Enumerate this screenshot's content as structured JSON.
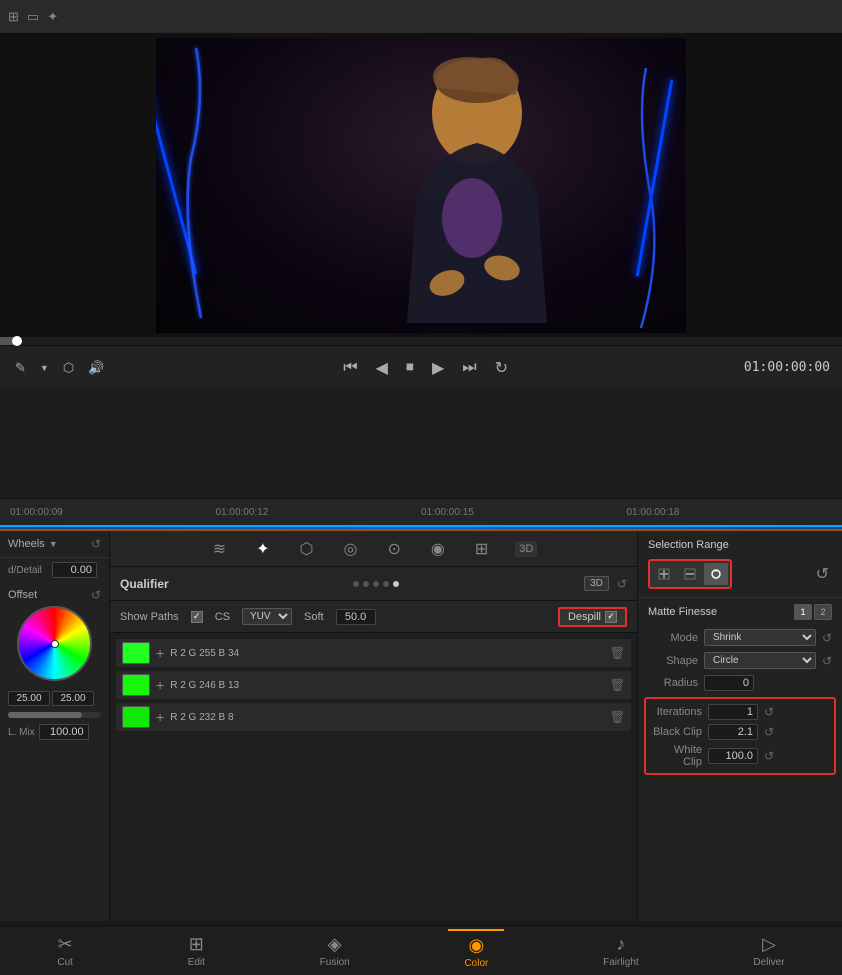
{
  "topToolbar": {
    "icons": [
      "grid-icon",
      "monitor-icon",
      "magic-icon"
    ]
  },
  "videoPreview": {
    "timecode": "01:00:00:00"
  },
  "playback": {
    "controls": [
      "skip-back",
      "step-back",
      "stop",
      "play",
      "step-forward",
      "loop"
    ],
    "timecode": "01:00:00:00"
  },
  "timeline": {
    "marks": [
      "01:00:00:09",
      "01:00:00:12",
      "01:00:00:15",
      "01:00:00:18"
    ]
  },
  "leftPanel": {
    "wheels_label": "Wheels",
    "detail_label": "d/Detail",
    "detail_value": "0.00",
    "offset_label": "Offset",
    "low_value": "25.00",
    "high_value": "25.00",
    "lmix_label": "L. Mix",
    "lmix_value": "100.00"
  },
  "toolIcons": [
    {
      "name": "curves-icon",
      "symbol": "≋"
    },
    {
      "name": "qualifier-icon",
      "symbol": "✦"
    },
    {
      "name": "pipette-icon",
      "symbol": "⬡"
    },
    {
      "name": "vignette-icon",
      "symbol": "◎"
    },
    {
      "name": "blur-icon",
      "symbol": "⊙"
    },
    {
      "name": "color-icon",
      "symbol": "◉"
    },
    {
      "name": "mask-icon",
      "symbol": "⊞"
    },
    {
      "name": "3d-icon",
      "symbol": "3D"
    }
  ],
  "qualifier": {
    "label": "Qualifier",
    "dots": [
      false,
      false,
      false,
      false,
      true
    ],
    "mode_label": "3D",
    "show_paths_label": "Show Paths",
    "show_paths_checked": true,
    "cs_label": "CS",
    "yuv_label": "YUV",
    "soft_label": "Soft",
    "soft_value": "50.0",
    "despill_label": "Despill",
    "despill_checked": true
  },
  "colorRows": [
    {
      "r": 2,
      "g": 255,
      "b": 34,
      "color": "#22ff22"
    },
    {
      "r": 2,
      "g": 246,
      "b": 13,
      "color": "#19f60d"
    },
    {
      "r": 2,
      "g": 232,
      "b": 8,
      "color": "#12e808"
    }
  ],
  "selectionRange": {
    "label": "Selection Range",
    "tools": [
      {
        "name": "add-color-tool",
        "symbol": "⚗"
      },
      {
        "name": "remove-color-tool",
        "symbol": "⚗"
      },
      {
        "name": "range-tool",
        "symbol": "⚗"
      }
    ],
    "cycle_icon": "↺"
  },
  "matteFinesse": {
    "label": "Matte Finesse",
    "tab1": "1",
    "tab2": "2",
    "mode_label": "Mode",
    "mode_value": "Shrink",
    "shape_label": "Shape",
    "shape_value": "Circle",
    "radius_label": "Radius",
    "radius_value": "0",
    "iterations_label": "Iterations",
    "iterations_value": "1",
    "black_clip_label": "Black Clip",
    "black_clip_value": "2.1",
    "white_clip_label": "White Clip",
    "white_clip_value": "100.0"
  },
  "bottomNav": [
    {
      "label": "Cut",
      "icon": "✂",
      "active": false,
      "name": "cut"
    },
    {
      "label": "Edit",
      "icon": "⊞",
      "active": false,
      "name": "edit"
    },
    {
      "label": "Fusion",
      "icon": "◈",
      "active": false,
      "name": "fusion"
    },
    {
      "label": "Color",
      "icon": "◉",
      "active": true,
      "name": "color"
    },
    {
      "label": "Fairlight",
      "icon": "♪",
      "active": false,
      "name": "fairlight"
    },
    {
      "label": "Deliver",
      "icon": "▷",
      "active": false,
      "name": "deliver"
    }
  ]
}
